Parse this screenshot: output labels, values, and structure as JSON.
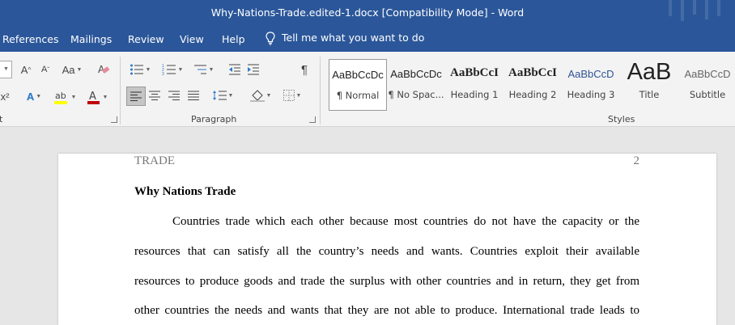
{
  "window": {
    "title": "Why-Nations-Trade.edited-1.docx [Compatibility Mode]  -  Word"
  },
  "menu": {
    "tabs": [
      "References",
      "Mailings",
      "Review",
      "View",
      "Help"
    ],
    "tell_me": "Tell me what you want to do"
  },
  "ribbon": {
    "font_group": {
      "superscript_label": "x²",
      "label": "t"
    },
    "paragraph_group": {
      "label": "Paragraph"
    },
    "styles_group": {
      "label": "Styles",
      "styles": [
        {
          "preview": "AaBbCcDc",
          "name": "¶ Normal"
        },
        {
          "preview": "AaBbCcDc",
          "name": "¶ No Spac..."
        },
        {
          "preview": "AaBbCcI",
          "name": "Heading 1"
        },
        {
          "preview": "AaBbCcI",
          "name": "Heading 2"
        },
        {
          "preview": "AaBbCcD",
          "name": "Heading 3"
        },
        {
          "preview": "AaB",
          "name": "Title"
        },
        {
          "preview": "AaBbCcD",
          "name": "Subtitle"
        }
      ]
    }
  },
  "document": {
    "header_left": "TRADE",
    "header_right": "2",
    "title": "Why Nations Trade",
    "lines": [
      "Countries trade which each other because most countries do not have the capacity or the",
      "resources that can satisfy all the country’s needs and wants. Countries exploit their available",
      "resources to produce goods and trade the surplus with other countries and in return, they get from",
      "other countries the needs and wants that they are not able to produce. International trade leads to"
    ]
  },
  "colors": {
    "title_bar": "#2b579a",
    "ribbon_bg": "#f3f3f3",
    "doc_bg": "#e6e6e6",
    "font_color_red": "#c00000",
    "highlight_yellow": "#ffff00"
  }
}
